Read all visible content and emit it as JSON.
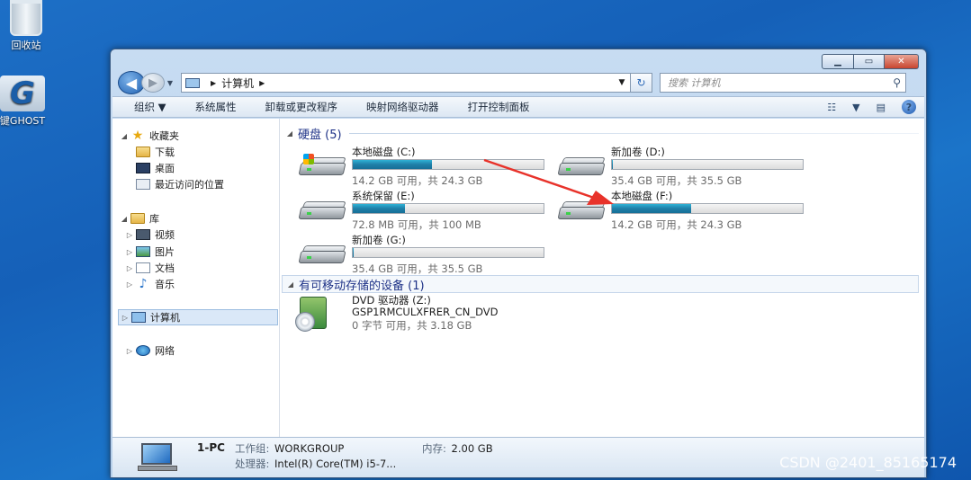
{
  "desktop": {
    "icons": [
      {
        "label": "回收站"
      },
      {
        "label": "键GHOST"
      }
    ],
    "watermark": "CSDN @2401_85165174"
  },
  "window": {
    "address": {
      "segments": [
        "计算机"
      ]
    },
    "search_placeholder": "搜索 计算机",
    "toolbar": {
      "items": [
        "组织 ▼",
        "系统属性",
        "卸载或更改程序",
        "映射网络驱动器",
        "打开控制面板"
      ]
    },
    "nav": {
      "favorites": {
        "label": "收藏夹",
        "children": [
          "下载",
          "桌面",
          "最近访问的位置"
        ]
      },
      "libraries": {
        "label": "库",
        "children": [
          "视频",
          "图片",
          "文档",
          "音乐"
        ]
      },
      "computer": "计算机",
      "network": "网络"
    },
    "hard_disks": {
      "title": "硬盘 (5)",
      "drives": [
        {
          "name": "本地磁盘 (C:)",
          "info": "14.2 GB 可用，共 24.3 GB",
          "used_fraction": 0.416,
          "system": true
        },
        {
          "name": "新加卷 (D:)",
          "info": "35.4 GB 可用，共 35.5 GB",
          "used_fraction": 0.003,
          "system": false
        },
        {
          "name": "系统保留 (E:)",
          "info": "72.8 MB 可用，共 100 MB",
          "used_fraction": 0.272,
          "system": false
        },
        {
          "name": "本地磁盘 (F:)",
          "info": "14.2 GB 可用，共 24.3 GB",
          "used_fraction": 0.416,
          "system": false
        },
        {
          "name": "新加卷 (G:)",
          "info": "35.4 GB 可用，共 35.5 GB",
          "used_fraction": 0.003,
          "system": false
        }
      ]
    },
    "removable": {
      "title": "有可移动存储的设备 (1)",
      "dvd": {
        "name": "DVD 驱动器 (Z:)",
        "label": "GSP1RMCULXFRER_CN_DVD",
        "info": "0 字节 可用，共 3.18 GB"
      }
    },
    "details": {
      "pc_name": "1-PC",
      "workgroup_label": "工作组:",
      "workgroup": "WORKGROUP",
      "memory_label": "内存:",
      "memory": "2.00 GB",
      "cpu_label": "处理器:",
      "cpu": "Intel(R) Core(TM) i5-7..."
    }
  },
  "colors": {
    "annotation_arrow": "#e8322a",
    "usage_bar": "#1f7fa8"
  }
}
